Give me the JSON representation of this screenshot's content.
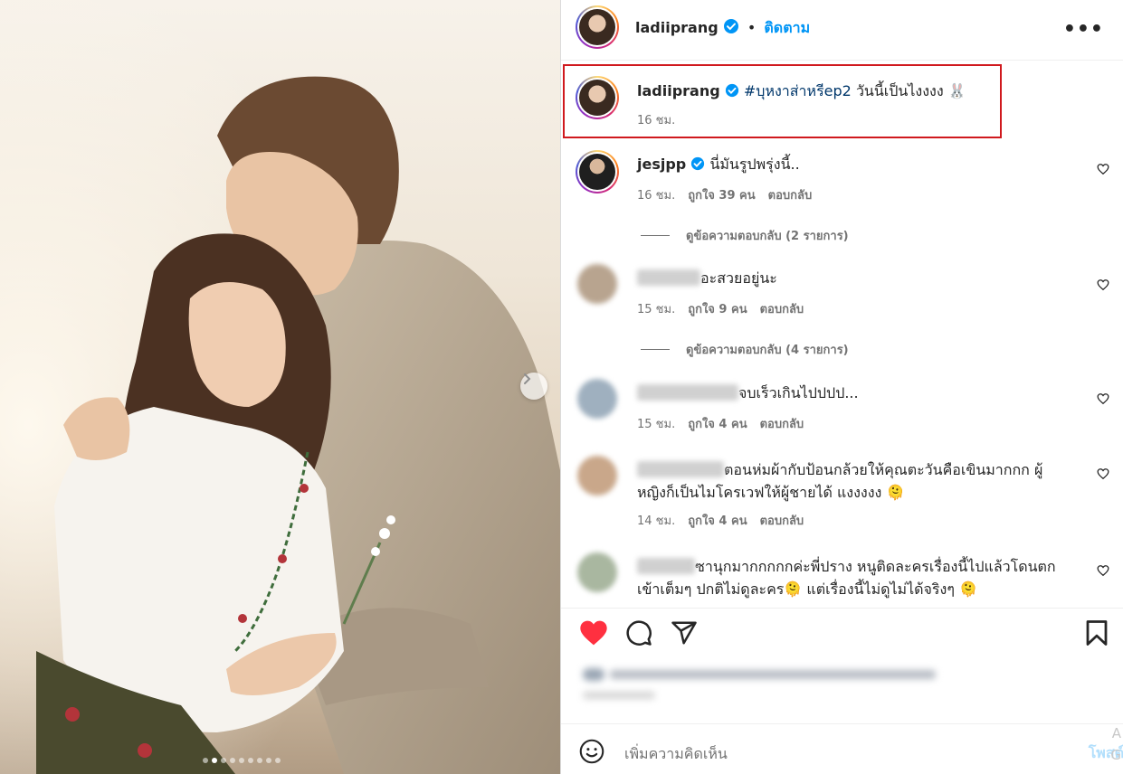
{
  "header": {
    "username": "ladiiprang",
    "separator": "•",
    "follow_label": "ติดตาม",
    "more_label": "•••"
  },
  "caption": {
    "username": "ladiiprang",
    "hashtag": "#บุหงาส่าหรีep2",
    "text": " วันนี้เป็นไงงงง 🐰",
    "time": "16 ชม."
  },
  "comments": [
    {
      "username": "jesjpp",
      "text": "นี่มันรูปพรุ่งนี้..",
      "time": "16 ชม.",
      "likes": "ถูกใจ 39 คน",
      "reply_label": "ตอบกลับ",
      "view_replies": "ดูข้อความตอบกลับ (2 รายการ)"
    },
    {
      "text": "อะสวยอยู่นะ",
      "time": "15 ชม.",
      "likes": "ถูกใจ 9 คน",
      "reply_label": "ตอบกลับ",
      "view_replies": "ดูข้อความตอบกลับ (4 รายการ)"
    },
    {
      "text": "จบเร็วเกินไปปปป...",
      "time": "15 ชม.",
      "likes": "ถูกใจ 4 คน",
      "reply_label": "ตอบกลับ"
    },
    {
      "text": "ตอนห่มผ้ากับป้อนกล้วยให้คุณตะวันคือเขินมากกก ผู้หญิงก็เป็นไมโครเวฟให้ผู้ชายได้ แงงงงง 🫠",
      "time": "14 ชม.",
      "likes": "ถูกใจ 4 คน",
      "reply_label": "ตอบกลับ"
    },
    {
      "text": "ซานุกมากกกกกค่ะพี่ปราง หนูติดละครเรื่องนี้ไปแล้วโดนตกเข้าเต็มๆ ปกติไม่ดูละคร🫠 แต่เรื่องนี้ไม่ดูไม่ได้จริงๆ 🫠"
    }
  ],
  "add_comment": {
    "placeholder": "เพิ่มความคิดเห็น",
    "post_label": "โพสต์"
  },
  "ghost_text": [
    "A",
    "G"
  ],
  "colors": {
    "accent": "#0095f6",
    "like_red": "#ff3040",
    "highlight_box": "#d0191e",
    "verified": "#0095f6"
  },
  "carousel": {
    "total_slides": 9,
    "active_slide": 2
  }
}
